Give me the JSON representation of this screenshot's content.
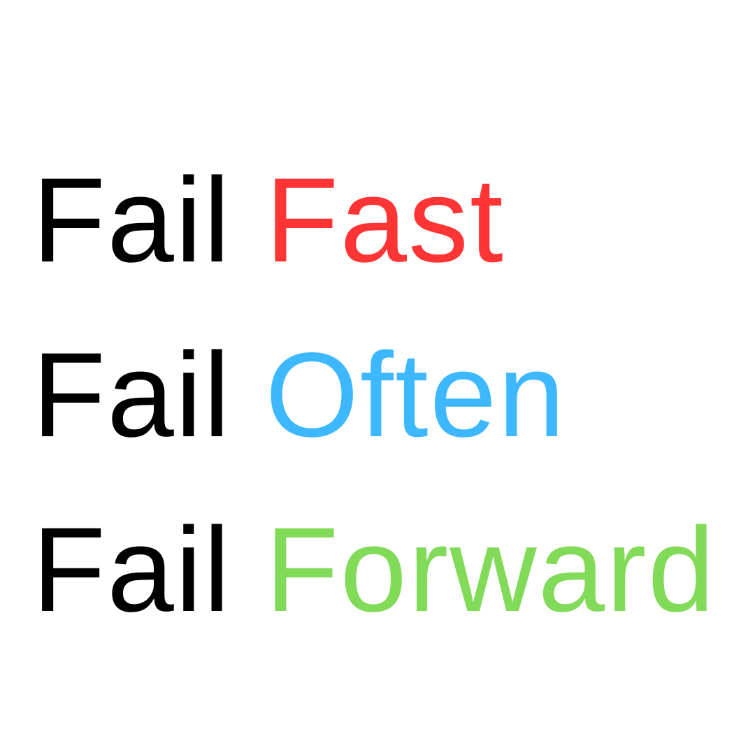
{
  "lines": [
    {
      "first": "Fail",
      "second": "Fast",
      "color": "#ff3535"
    },
    {
      "first": "Fail",
      "second": "Often",
      "color": "#3db8ff"
    },
    {
      "first": "Fail",
      "second": "Forward",
      "color": "#82da59"
    }
  ]
}
